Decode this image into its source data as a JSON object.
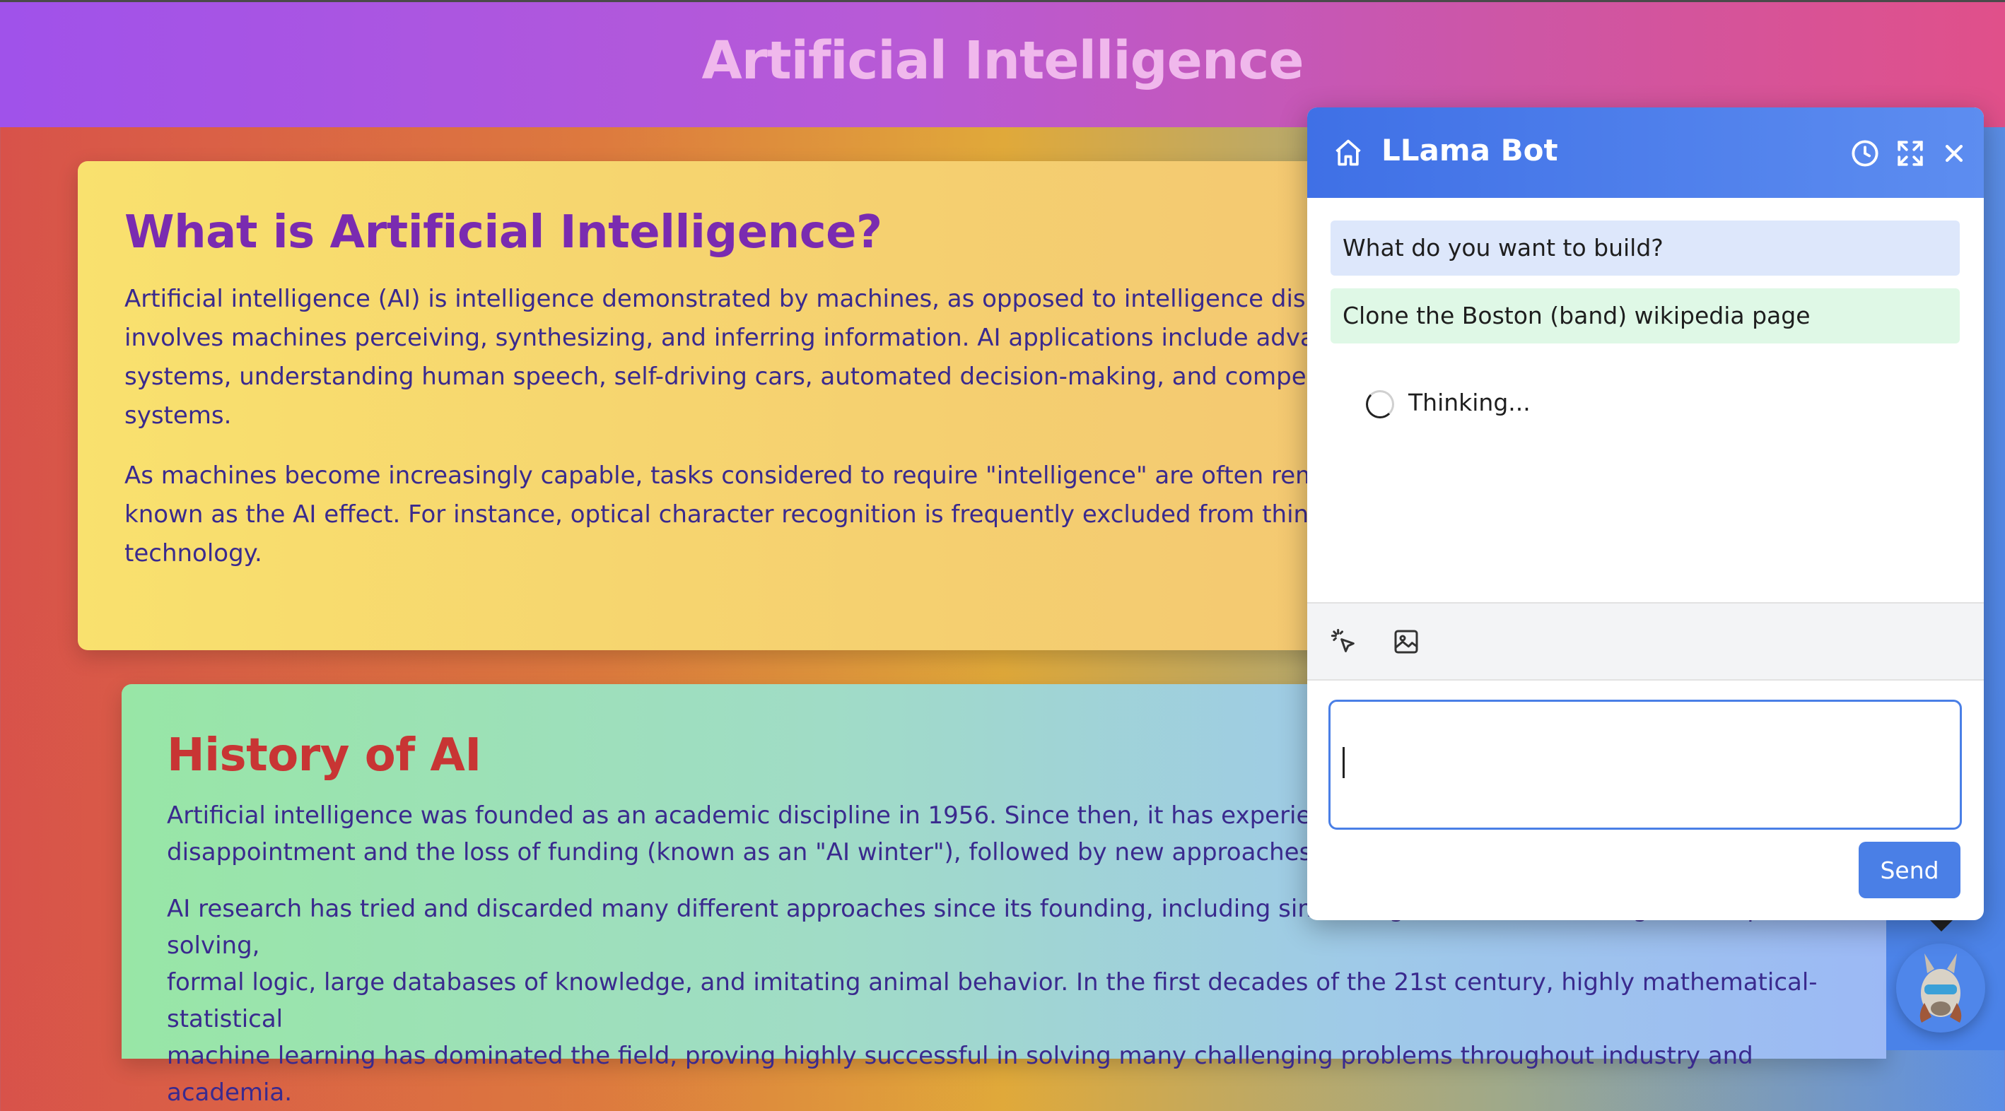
{
  "page": {
    "title": "Artificial Intelligence"
  },
  "sections": [
    {
      "heading": "What is Artificial Intelligence?",
      "paragraphs": [
        "Artificial intelligence (AI) is intelligence demonstrated by machines, as opposed to intelligence displ\ninvolves machines perceiving, synthesizing, and inferring information. AI applications include advan\nsystems, understanding human speech, self-driving cars, automated decision-making, and compe\nsystems.",
        "As machines become increasingly capable, tasks considered to require \"intelligence\" are often remo\nknown as the AI effect. For instance, optical character recognition is frequently excluded from things\ntechnology."
      ]
    },
    {
      "heading": "History of AI",
      "paragraphs": [
        "Artificial intelligence was founded as an academic discipline in 1956. Since then, it has experienced se\ndisappointment and the loss of funding (known as an \"AI winter\"), followed by new approaches, succe",
        "AI research has tried and discarded many different approaches since its founding, including simulating the brain, modeling human problem solving,\nformal logic, large databases of knowledge, and imitating animal behavior. In the first decades of the 21st century, highly mathematical-statistical\nmachine learning has dominated the field, proving highly successful in solving many challenging problems throughout industry and academia."
      ]
    }
  ],
  "chat": {
    "title": "LLama Bot",
    "header_icons": [
      "home-icon",
      "history-icon",
      "expand-icon",
      "close-icon"
    ],
    "messages": [
      {
        "role": "bot",
        "text": "What do you want to build?"
      },
      {
        "role": "user",
        "text": "Clone the Boston (band) wikipedia page"
      }
    ],
    "status": "Thinking...",
    "tools": [
      "element-picker-icon",
      "image-icon"
    ],
    "input_value": "",
    "send_label": "Send"
  },
  "colors": {
    "chat_header": "#4a7fe6",
    "bot_bubble": "#dde7fb",
    "user_bubble": "#dff8e6"
  }
}
